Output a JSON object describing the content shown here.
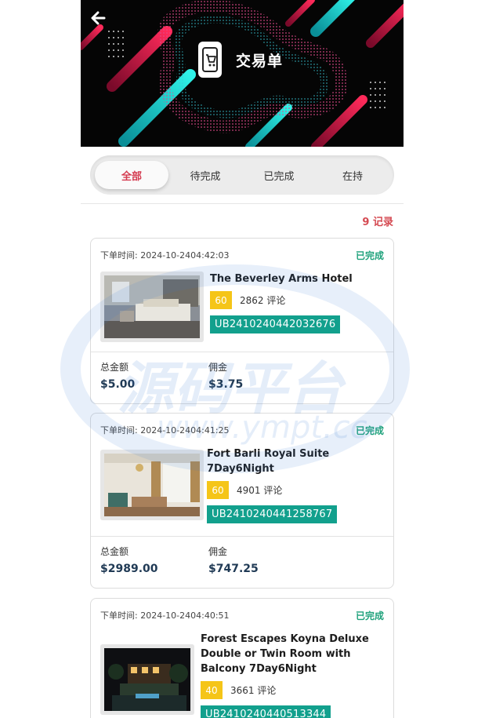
{
  "header": {
    "title": "交易单",
    "back_icon": "arrow-left-icon",
    "app_icon": "shopping-cart-phone-icon"
  },
  "tabs": [
    {
      "label": "全部",
      "active": true
    },
    {
      "label": "待完成",
      "active": false
    },
    {
      "label": "已完成",
      "active": false
    },
    {
      "label": "在持",
      "active": false
    }
  ],
  "record_count": "9 记录",
  "orders": [
    {
      "time": "下单时间: 2024-10-2404:42:03",
      "status": "已完成",
      "hotel_lines": [
        "The Beverley Arms Hotel"
      ],
      "score": "60",
      "reviews": "2862 评论",
      "order_no": "UB2410240442032676",
      "total_label": "总金额",
      "total": "$5.00",
      "commission_label": "佣金",
      "commission": "$3.75"
    },
    {
      "time": "下单时间: 2024-10-2404:41:25",
      "status": "已完成",
      "hotel_lines": [
        "Fort Barli Royal Suite",
        "7Day6Night"
      ],
      "score": "60",
      "reviews": "4901 评论",
      "order_no": "UB2410240441258767",
      "total_label": "总金额",
      "total": "$2989.00",
      "commission_label": "佣金",
      "commission": "$747.25"
    },
    {
      "time": "下单时间: 2024-10-2404:40:51",
      "status": "已完成",
      "hotel_lines": [
        "Forest Escapes Koyna Deluxe",
        "Double or Twin Room with",
        "Balcony 7Day6Night"
      ],
      "score": "40",
      "reviews": "3661 评论",
      "order_no": "UB2410240440513344"
    }
  ],
  "watermark": {
    "line1": "源码平台",
    "line2": "www.ympt.cc"
  },
  "colors": {
    "accent_red": "#d43a4f",
    "status_green": "#20a27c",
    "score_yellow": "#f5c518",
    "order_teal": "#12a08d"
  }
}
